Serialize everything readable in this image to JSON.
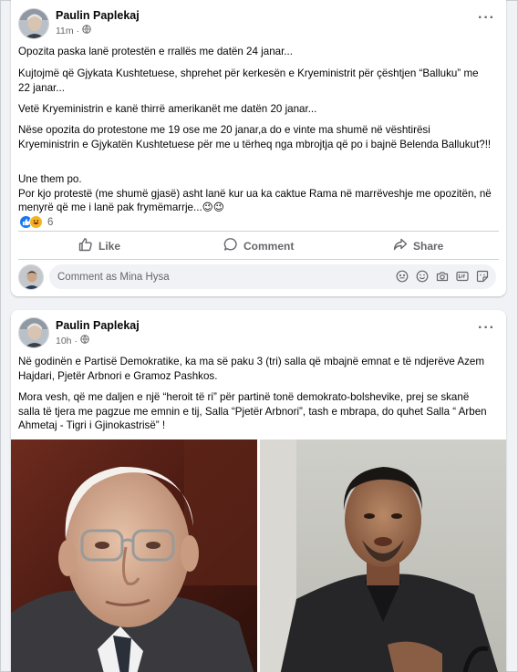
{
  "posts": [
    {
      "author": "Paulin Paplekaj",
      "time": "11m",
      "dot": "·",
      "paragraphs": [
        "Opozita paska lanë protestën e rrallës me datën 24 janar...",
        "Kujtojmë që Gjykata Kushtetuese, shprehet për kerkesën e Kryeministrit për çështjen “Balluku” me 22 janar...",
        "Vetë Kryeministrin e kanë thirrë amerikanët me datën 20 janar...",
        "Nëse opozita do protestone me 19 ose me 20 janar,a do e vinte ma shumë në vështirësi Kryeministrin e Gjykatën Kushtetuese për me u tërheq nga mbrojtja që po i bajnë Belenda Ballukut?!!",
        "Une them po.\nPor kjo protestë (me shumë gjasë) asht lanë kur ua ka caktue Rama në marrëveshje me opozitën, në menyrë që me i lanë pak frymëmarrje...😉😉"
      ],
      "reaction_count": "6",
      "actions": {
        "like": "Like",
        "comment": "Comment",
        "share": "Share"
      },
      "comment_placeholder": "Comment as Mina Hysa"
    },
    {
      "author": "Paulin Paplekaj",
      "time": "10h",
      "dot": "·",
      "paragraphs": [
        "Në godinën e Partisë Demokratike, ka ma së paku 3 (tri) salla që mbajnë emnat e të ndjerëve Azem Hajdari, Pjetër Arbnori e Gramoz Pashkos.",
        "Mora vesh, që me daljen e një “heroit të ri” për partinë tonë demokrato-bolshevike, prej se skanë salla të tjera me pagzue me emnin e tij, Salla “Pjetër Arbnori”, tash e mbrapa, do quhet Salla “ Arben Ahmetaj - Tigri i Gjinokastrisë” !"
      ]
    }
  ],
  "icons": {
    "globe": "globe-icon",
    "more": "more-options-icon",
    "like": "thumbs-up-icon",
    "comment": "speech-bubble-icon",
    "share": "share-arrow-icon"
  },
  "colors": {
    "fb_blue": "#1877f2",
    "muted": "#65676b",
    "background": "#f0f2f5"
  }
}
